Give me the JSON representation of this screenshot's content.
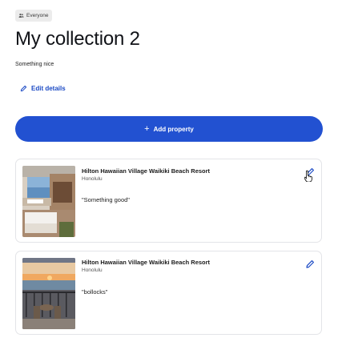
{
  "badge": {
    "label": "Everyone",
    "icon": "people-icon"
  },
  "header": {
    "title": "My collection 2",
    "subtitle": "Something nice"
  },
  "edit_details": {
    "label": "Edit details",
    "icon": "pencil-icon"
  },
  "add_property": {
    "label": "Add property",
    "icon": "plus-icon"
  },
  "properties": [
    {
      "name": "Hilton Hawaiian Village Waikiki Beach Resort",
      "location": "Honolulu",
      "note": "\"Something good\""
    },
    {
      "name": "Hilton Hawaiian Village Waikiki Beach Resort",
      "location": "Honolulu",
      "note": "\"bollocks\""
    }
  ],
  "colors": {
    "accent": "#2251d1",
    "link": "#1a49c4"
  }
}
